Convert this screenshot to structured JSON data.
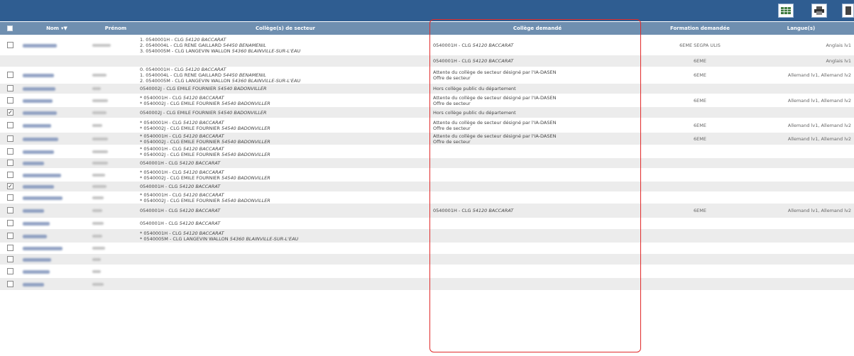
{
  "header": {
    "columns": {
      "nom": "Nom",
      "prenom": "Prénom",
      "secteur": "Collège(s) de secteur",
      "demande": "Collège demandé",
      "formation": "Formation demandée",
      "langues": "Langue(s)"
    }
  },
  "colors": {
    "topbar": "#2f5d91",
    "header": "#6f8fb0",
    "alt_row": "#ececec",
    "highlight": "#e02a2a"
  },
  "toolbar": {
    "icons": [
      "grid-view-icon",
      "print-icon",
      "export-icon"
    ]
  },
  "rows": [
    {
      "checked": false,
      "secteur": [
        [
          "1. 0540001H - CLG ",
          "54120 BACCARAT"
        ],
        [
          "2. 0540004L - CLG RENE GAILLARD ",
          "54450 BENAMENIL"
        ],
        [
          "3. 0540005M - CLG LANGEVIN WALLON ",
          "54360 BLAINVILLE-SUR-L'EAU"
        ]
      ],
      "demande": [
        [
          "0540001H - CLG ",
          "54120 BACCARAT"
        ]
      ],
      "formation": "6EME SEGPA ULIS",
      "langues": "Anglais lv1"
    },
    {
      "checked": null,
      "secteur": [],
      "demande": [
        [
          "0540001H - CLG ",
          "54120 BACCARAT"
        ]
      ],
      "formation": "6EME",
      "langues": "Anglais lv1"
    },
    {
      "checked": false,
      "secteur": [
        [
          "0. 0540001H - CLG ",
          "54120 BACCARAT"
        ],
        [
          "1. 0540004L - CLG RENE GAILLARD ",
          "54450 BENAMENIL"
        ],
        [
          "2. 0540005M - CLG LANGEVIN WALLON ",
          "54360 BLAINVILLE-SUR-L'EAU"
        ]
      ],
      "demande": [
        [
          "Attente du collège de secteur désigné par l'IA-DASEN",
          ""
        ],
        [
          "Offre de secteur",
          ""
        ]
      ],
      "formation": "6EME",
      "langues": "Allemand lv1, Allemand lv2"
    },
    {
      "checked": false,
      "secteur": [
        [
          "0540002J - CLG EMILE FOURNIER ",
          "54540 BADONVILLER"
        ]
      ],
      "demande": [
        [
          "Hors collège public du département",
          ""
        ]
      ],
      "formation": "",
      "langues": ""
    },
    {
      "checked": false,
      "secteur": [
        [
          "* 0540001H - CLG ",
          "54120 BACCARAT"
        ],
        [
          "* 0540002J - CLG EMILE FOURNIER ",
          "54540 BADONVILLER"
        ]
      ],
      "demande": [
        [
          "Attente du collège de secteur désigné par l'IA-DASEN",
          ""
        ],
        [
          "Offre de secteur",
          ""
        ]
      ],
      "formation": "6EME",
      "langues": "Allemand lv1, Allemand lv2"
    },
    {
      "checked": true,
      "secteur": [
        [
          "0540002J - CLG EMILE FOURNIER ",
          "54540 BADONVILLER"
        ]
      ],
      "demande": [
        [
          "Hors collège public du département",
          ""
        ]
      ],
      "formation": "",
      "langues": ""
    },
    {
      "checked": false,
      "secteur": [
        [
          "* 0540001H - CLG ",
          "54120 BACCARAT"
        ],
        [
          "* 0540002J - CLG EMILE FOURNIER ",
          "54540 BADONVILLER"
        ]
      ],
      "demande": [
        [
          "Attente du collège de secteur désigné par l'IA-DASEN",
          ""
        ],
        [
          "Offre de secteur",
          ""
        ]
      ],
      "formation": "6EME",
      "langues": "Allemand lv1, Allemand lv2"
    },
    {
      "checked": false,
      "secteur": [
        [
          "* 0540001H - CLG ",
          "54120 BACCARAT"
        ],
        [
          "* 0540002J - CLG EMILE FOURNIER ",
          "54540 BADONVILLER"
        ]
      ],
      "demande": [
        [
          "Attente du collège de secteur désigné par l'IA-DASEN",
          ""
        ],
        [
          "Offre de secteur",
          ""
        ]
      ],
      "formation": "6EME",
      "langues": "Allemand lv1, Allemand lv2"
    },
    {
      "checked": false,
      "secteur": [
        [
          "* 0540001H - CLG ",
          "54120 BACCARAT"
        ],
        [
          "* 0540002J - CLG EMILE FOURNIER ",
          "54540 BADONVILLER"
        ]
      ],
      "demande": [],
      "formation": "",
      "langues": ""
    },
    {
      "checked": false,
      "secteur": [
        [
          "0540001H - CLG ",
          "54120 BACCARAT"
        ]
      ],
      "demande": [],
      "formation": "",
      "langues": ""
    },
    {
      "checked": false,
      "secteur": [
        [
          "* 0540001H - CLG ",
          "54120 BACCARAT"
        ],
        [
          "* 0540002J - CLG EMILE FOURNIER ",
          "54540 BADONVILLER"
        ]
      ],
      "demande": [],
      "formation": "",
      "langues": ""
    },
    {
      "checked": true,
      "secteur": [
        [
          "0540001H - CLG ",
          "54120 BACCARAT"
        ]
      ],
      "demande": [],
      "formation": "",
      "langues": ""
    },
    {
      "checked": false,
      "secteur": [
        [
          "* 0540001H - CLG ",
          "54120 BACCARAT"
        ],
        [
          "* 0540002J - CLG EMILE FOURNIER ",
          "54540 BADONVILLER"
        ]
      ],
      "demande": [],
      "formation": "",
      "langues": ""
    },
    {
      "checked": false,
      "secteur": [
        [
          "0540001H - CLG ",
          "54120 BACCARAT"
        ]
      ],
      "demande": [
        [
          "0540001H - CLG ",
          "54120 BACCARAT"
        ]
      ],
      "formation": "6EME",
      "langues": "Allemand lv1, Allemand lv2"
    },
    {
      "checked": false,
      "secteur": [
        [
          "0540001H - CLG ",
          "54120 BACCARAT"
        ]
      ],
      "demande": [],
      "formation": "",
      "langues": ""
    },
    {
      "checked": false,
      "secteur": [
        [
          "* 0540001H - CLG ",
          "54120 BACCARAT"
        ],
        [
          "* 0540005M - CLG LANGEVIN WALLON ",
          "54360 BLAINVILLE-SUR-L'EAU"
        ]
      ],
      "demande": [],
      "formation": "",
      "langues": ""
    },
    {
      "checked": false,
      "secteur": [],
      "demande": [],
      "formation": "",
      "langues": ""
    },
    {
      "checked": false,
      "secteur": [],
      "demande": [],
      "formation": "",
      "langues": ""
    },
    {
      "checked": false,
      "secteur": [],
      "demande": [],
      "formation": "",
      "langues": ""
    },
    {
      "checked": false,
      "secteur": [],
      "demande": [],
      "formation": "",
      "langues": ""
    }
  ]
}
